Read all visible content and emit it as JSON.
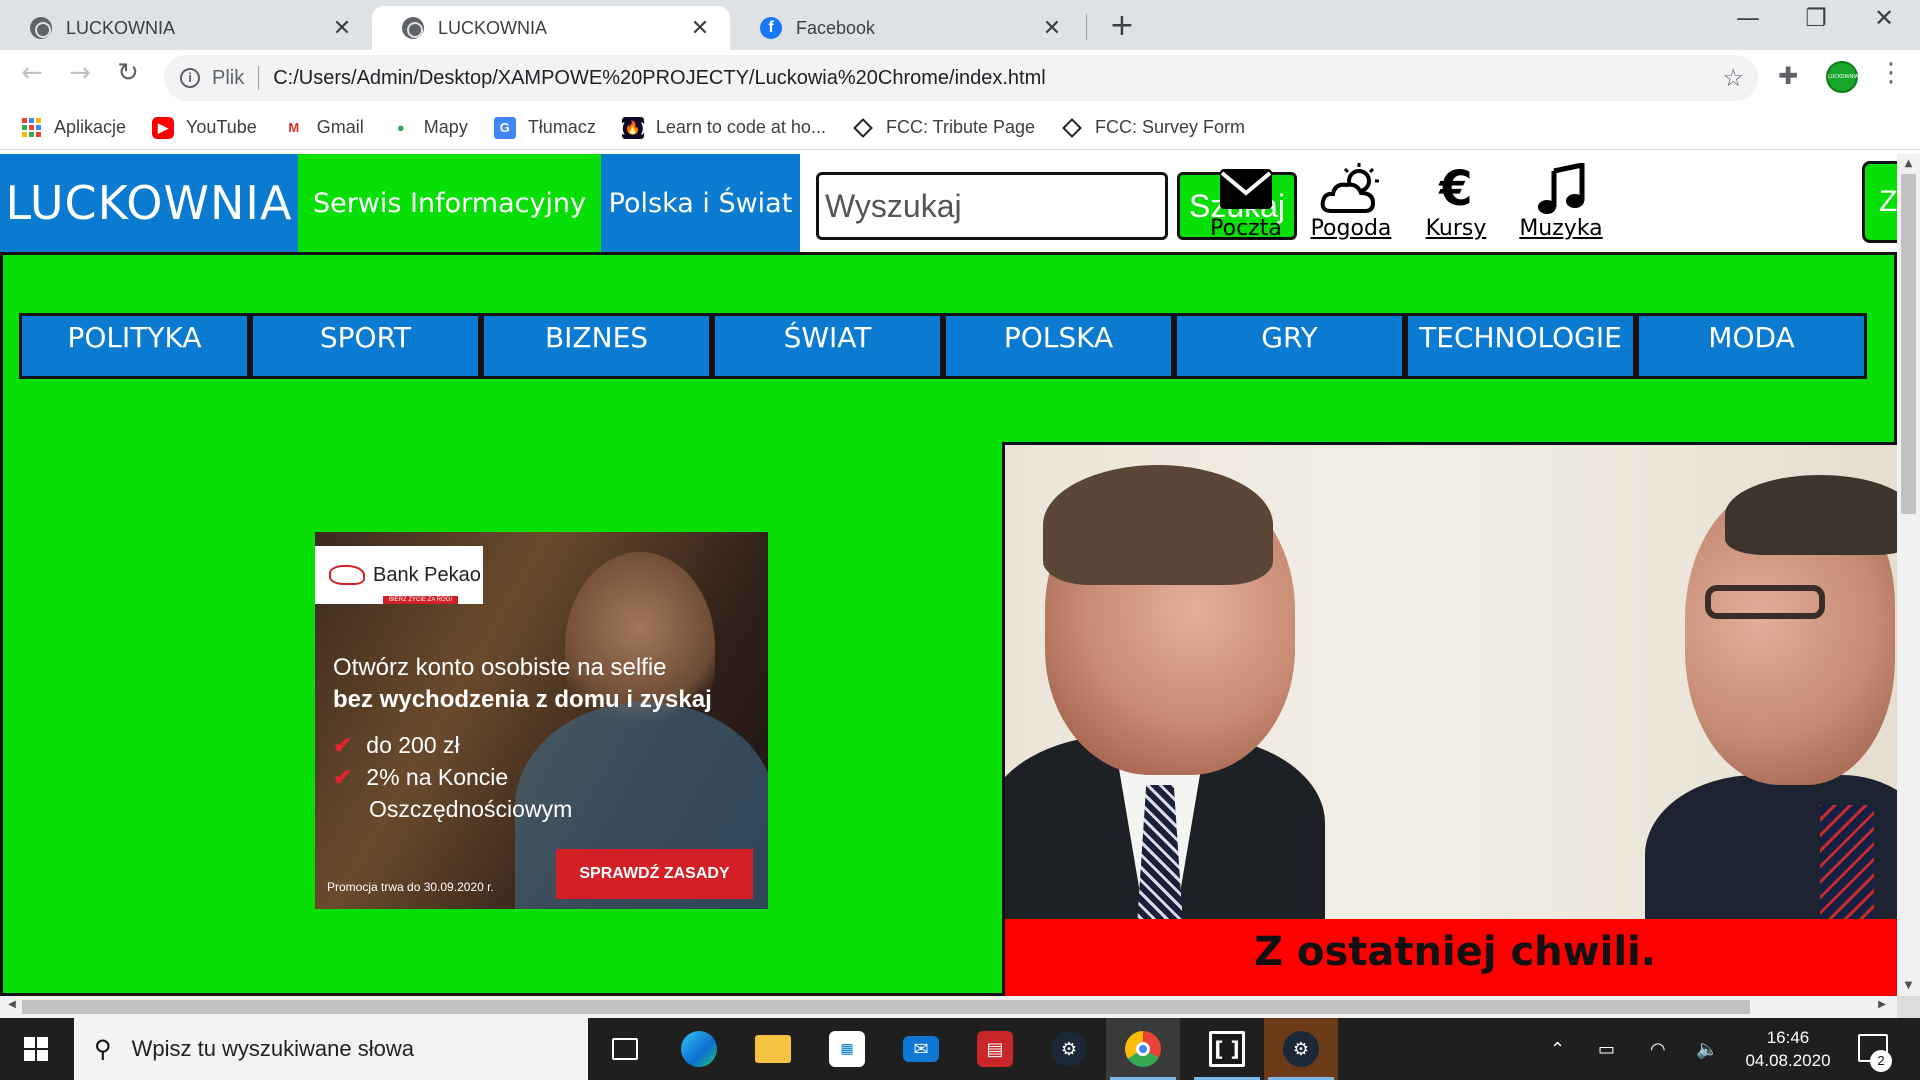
{
  "browser": {
    "tabs": [
      {
        "title": "LUCKOWNIA",
        "icon": "globe-icon",
        "active": false
      },
      {
        "title": "LUCKOWNIA",
        "icon": "globe-icon",
        "active": true
      },
      {
        "title": "Facebook",
        "icon": "facebook-icon",
        "active": false
      }
    ],
    "omnibox": {
      "scheme_label": "Plik",
      "url": "C:/Users/Admin/Desktop/XAMPOWE%20PROJECTY/Luckowia%20Chrome/index.html"
    },
    "bookmarks": [
      {
        "label": "Aplikacje",
        "icon": "apps-grid-icon"
      },
      {
        "label": "YouTube",
        "icon": "youtube-icon"
      },
      {
        "label": "Gmail",
        "icon": "gmail-icon"
      },
      {
        "label": "Mapy",
        "icon": "maps-icon"
      },
      {
        "label": "Tłumacz",
        "icon": "translate-icon"
      },
      {
        "label": "Learn to code at ho...",
        "icon": "freecodecamp-icon"
      },
      {
        "label": "FCC: Tribute Page",
        "icon": "codepen-icon"
      },
      {
        "label": "FCC: Survey Form",
        "icon": "codepen-icon"
      }
    ]
  },
  "site": {
    "logo": "LUCKOWNIA",
    "tagline": "Serwis Informacyjny",
    "region": "Polska i Świat",
    "search": {
      "placeholder": "Wyszukaj",
      "button": "Szukaj"
    },
    "shortcuts": [
      {
        "label": "Poczta",
        "icon": "envelope-icon"
      },
      {
        "label": "Pogoda",
        "icon": "weather-cloud-sun-icon"
      },
      {
        "label": "Kursy",
        "icon": "euro-icon"
      },
      {
        "label": "Muzyka",
        "icon": "music-note-icon"
      }
    ],
    "login": "Zaloguj się",
    "categories": [
      "POLITYKA",
      "SPORT",
      "BIZNES",
      "ŚWIAT",
      "POLSKA",
      "GRY",
      "TECHNOLOGIE",
      "MODA"
    ],
    "ad": {
      "brand": "Bank Pekao",
      "brand_tagline": "BIERZ ŻYCIE ZA ROGI",
      "line1": "Otwórz konto osobiste na selfie",
      "line2": "bez wychodzenia z domu i zyskaj",
      "bullets": [
        "do 200 zł",
        "2% na Koncie",
        "Oszczędnościowym"
      ],
      "note": "Promocja trwa do 30.09.2020 r.",
      "cta": "SPRAWDŹ ZASADY"
    },
    "news": {
      "headline": "Z ostatniej chwili."
    }
  },
  "taskbar": {
    "search_placeholder": "Wpisz tu wyszukiwane słowa",
    "apps": [
      {
        "name": "task-view",
        "icon": "task-view-icon"
      },
      {
        "name": "edge",
        "icon": "edge-icon"
      },
      {
        "name": "file-explorer",
        "icon": "folder-icon"
      },
      {
        "name": "store",
        "icon": "store-icon"
      },
      {
        "name": "mail",
        "icon": "mail-icon"
      },
      {
        "name": "reader",
        "icon": "reader-icon"
      },
      {
        "name": "steam",
        "icon": "steam-icon"
      },
      {
        "name": "chrome",
        "icon": "chrome-icon"
      },
      {
        "name": "app",
        "icon": "bracket-app-icon"
      },
      {
        "name": "steam-running",
        "icon": "steam-icon"
      }
    ],
    "time": "16:46",
    "date": "04.08.2020",
    "notification_count": "2"
  }
}
